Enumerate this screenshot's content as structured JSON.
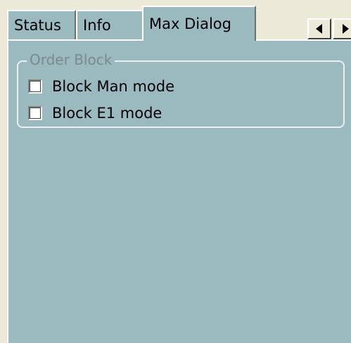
{
  "tabs": [
    {
      "label": "Status",
      "active": false
    },
    {
      "label": "Info",
      "active": false
    },
    {
      "label": "Max Dialog",
      "active": true
    }
  ],
  "tab_scroll": {
    "left_icon": "triangle-left-icon",
    "right_icon": "triangle-right-icon"
  },
  "order_block": {
    "title": "Order Block",
    "options": [
      {
        "label": "Block Man mode",
        "checked": false
      },
      {
        "label": "Block E1 mode",
        "checked": false
      }
    ]
  },
  "colors": {
    "panel": "#9bbac0",
    "window": "#ece9d8",
    "group_title": "#7a8a8d"
  }
}
